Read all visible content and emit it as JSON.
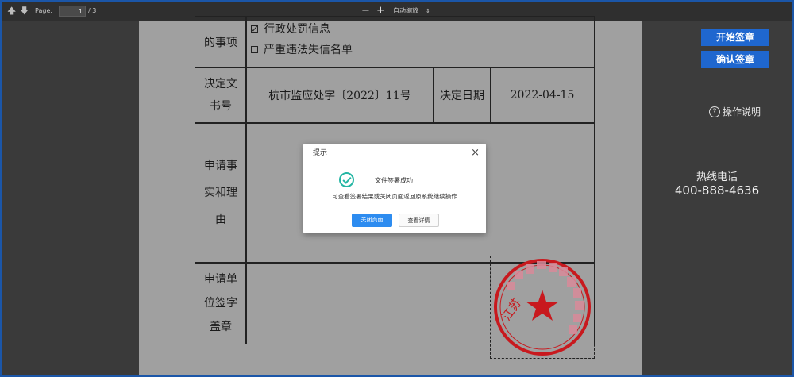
{
  "toolbar": {
    "page_label": "Page:",
    "current_page": "1",
    "total_pages": "/ 3",
    "zoom_out": "−",
    "zoom_in": "+",
    "zoom_mode": "自动缩放",
    "zoom_caret": "⇕"
  },
  "document": {
    "row1_label": "的事项",
    "checkbox_items": [
      {
        "label": "行政处罚信息",
        "checked": true
      },
      {
        "label": "严重违法失信名单",
        "checked": false
      }
    ],
    "row2_label_line1": "决定文",
    "row2_label_line2": "书号",
    "decision_number": "杭市监应处字〔2022〕11号",
    "decision_date_label": "决定日期",
    "decision_date": "2022-04-15",
    "row3_label_line1": "申请事",
    "row3_label_line2": "实和理",
    "row3_label_line3": "由",
    "row4_label_line1": "申请单",
    "row4_label_line2": "位签字",
    "row4_label_line3": "盖章",
    "seal_text": "江苏"
  },
  "side": {
    "start_sign_label": "开始签章",
    "confirm_sign_label": "确认签章",
    "help_label": "操作说明",
    "hotline_label": "热线电话",
    "hotline_number": "400-888-4636"
  },
  "modal": {
    "title": "提示",
    "close": "×",
    "success_title": "文件签署成功",
    "message": "可查看签署结果或关闭页面返回原系统继续操作",
    "close_page_label": "关闭页面",
    "view_detail_label": "查看详情"
  },
  "colors": {
    "accent": "#1f67cf",
    "success": "#25b6a4",
    "seal_red": "#c8191e"
  }
}
